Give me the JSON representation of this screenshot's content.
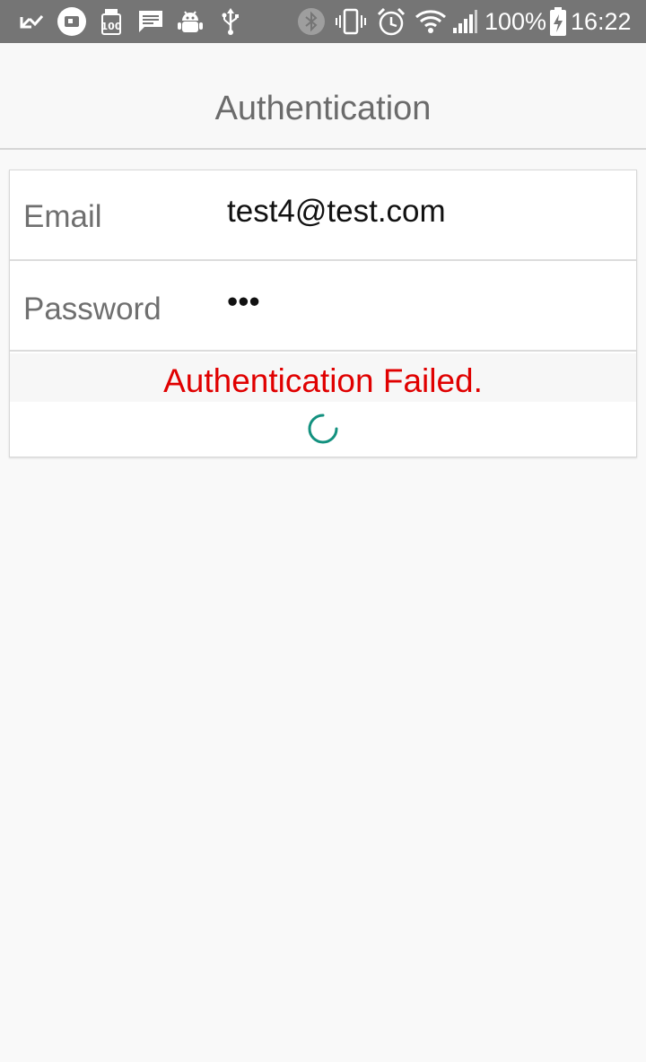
{
  "status_bar": {
    "battery_text": "100%",
    "time": "16:22",
    "left_icons": [
      "missed-call-icon",
      "app-badge-icon",
      "storage-100-icon",
      "message-icon",
      "android-debug-icon",
      "usb-icon"
    ],
    "right_icons": [
      "bluetooth-icon",
      "vibrate-icon",
      "alarm-icon",
      "wifi-icon",
      "signal-icon",
      "battery-charging-icon"
    ],
    "background_color": "#757575"
  },
  "header": {
    "title": "Authentication"
  },
  "form": {
    "email_label": "Email",
    "email_value": "test4@test.com",
    "password_label": "Password",
    "password_value": "•••",
    "error_message": "Authentication Failed."
  },
  "colors": {
    "error": "#e00000",
    "spinner": "#13917f",
    "label": "#6f6f6f"
  }
}
